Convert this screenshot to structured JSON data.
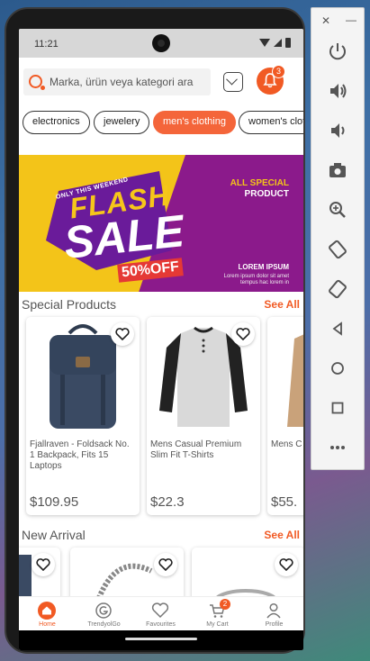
{
  "status_bar": {
    "time": "11:21"
  },
  "search": {
    "placeholder": "Marka, ürün veya kategori ara"
  },
  "notifications": {
    "count": "3"
  },
  "categories": [
    {
      "label": "electronics",
      "active": false
    },
    {
      "label": "jewelery",
      "active": false
    },
    {
      "label": "men's clothing",
      "active": true
    },
    {
      "label": "women's clothing",
      "active": false
    }
  ],
  "banner": {
    "tagline": "ONLY THIS WEEKEND",
    "headline_1": "FLASH",
    "headline_2": "SALE",
    "discount": "50%OFF",
    "side_title": "ALL SPECIAL",
    "side_subtitle": "PRODUCT",
    "footer_title": "LOREM IPSUM",
    "footer_text": "Lorem ipsum dolor sit amet tempus hac lorem in"
  },
  "special_products": {
    "title": "Special Products",
    "see_all": "See All",
    "items": [
      {
        "name": "Fjallraven - Foldsack No. 1 Backpack, Fits 15 Laptops",
        "price": "$109.95"
      },
      {
        "name": "Mens Casual Premium Slim Fit T-Shirts",
        "price": "$22.3"
      },
      {
        "name": "Mens C",
        "price": "$55."
      }
    ]
  },
  "new_arrival": {
    "title": "New Arrival",
    "see_all": "See All"
  },
  "bottom_nav": {
    "items": [
      {
        "label": "Home",
        "icon": "home-icon",
        "active": true
      },
      {
        "label": "TrendyolGo",
        "icon": "go-icon",
        "active": false
      },
      {
        "label": "Favourites",
        "icon": "heart-icon",
        "active": false
      },
      {
        "label": "My Cart",
        "icon": "cart-icon",
        "active": false,
        "badge": "2"
      },
      {
        "label": "Profile",
        "icon": "profile-icon",
        "active": false
      }
    ]
  },
  "colors": {
    "accent": "#f15a24",
    "chip_active": "#f4653a",
    "banner_purple": "#8b1a8b",
    "banner_yellow": "#f3c419"
  },
  "emulator_toolbar": {
    "buttons": [
      "power-icon",
      "volume-up-icon",
      "volume-down-icon",
      "camera-icon",
      "zoom-icon",
      "rotate-left-icon",
      "rotate-right-icon",
      "back-icon",
      "home-circle-icon",
      "overview-icon",
      "more-icon"
    ]
  }
}
